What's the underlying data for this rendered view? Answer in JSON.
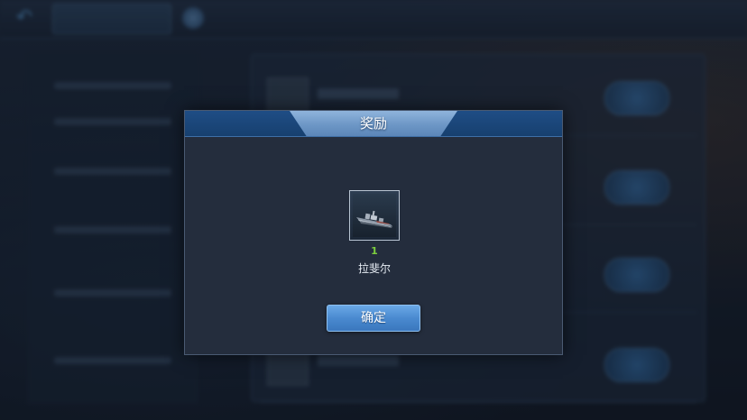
{
  "dialog": {
    "title": "奖励",
    "confirm_label": "确定"
  },
  "reward": {
    "icon": "warship-icon",
    "count": "1",
    "name": "拉斐尔"
  },
  "colors": {
    "title_bar": "#1f4d85",
    "title_plate": "#7aa2d0",
    "count_green": "#7dcf3e",
    "button_blue": "#4a8ad0",
    "modal_bg": "#242d3d"
  }
}
